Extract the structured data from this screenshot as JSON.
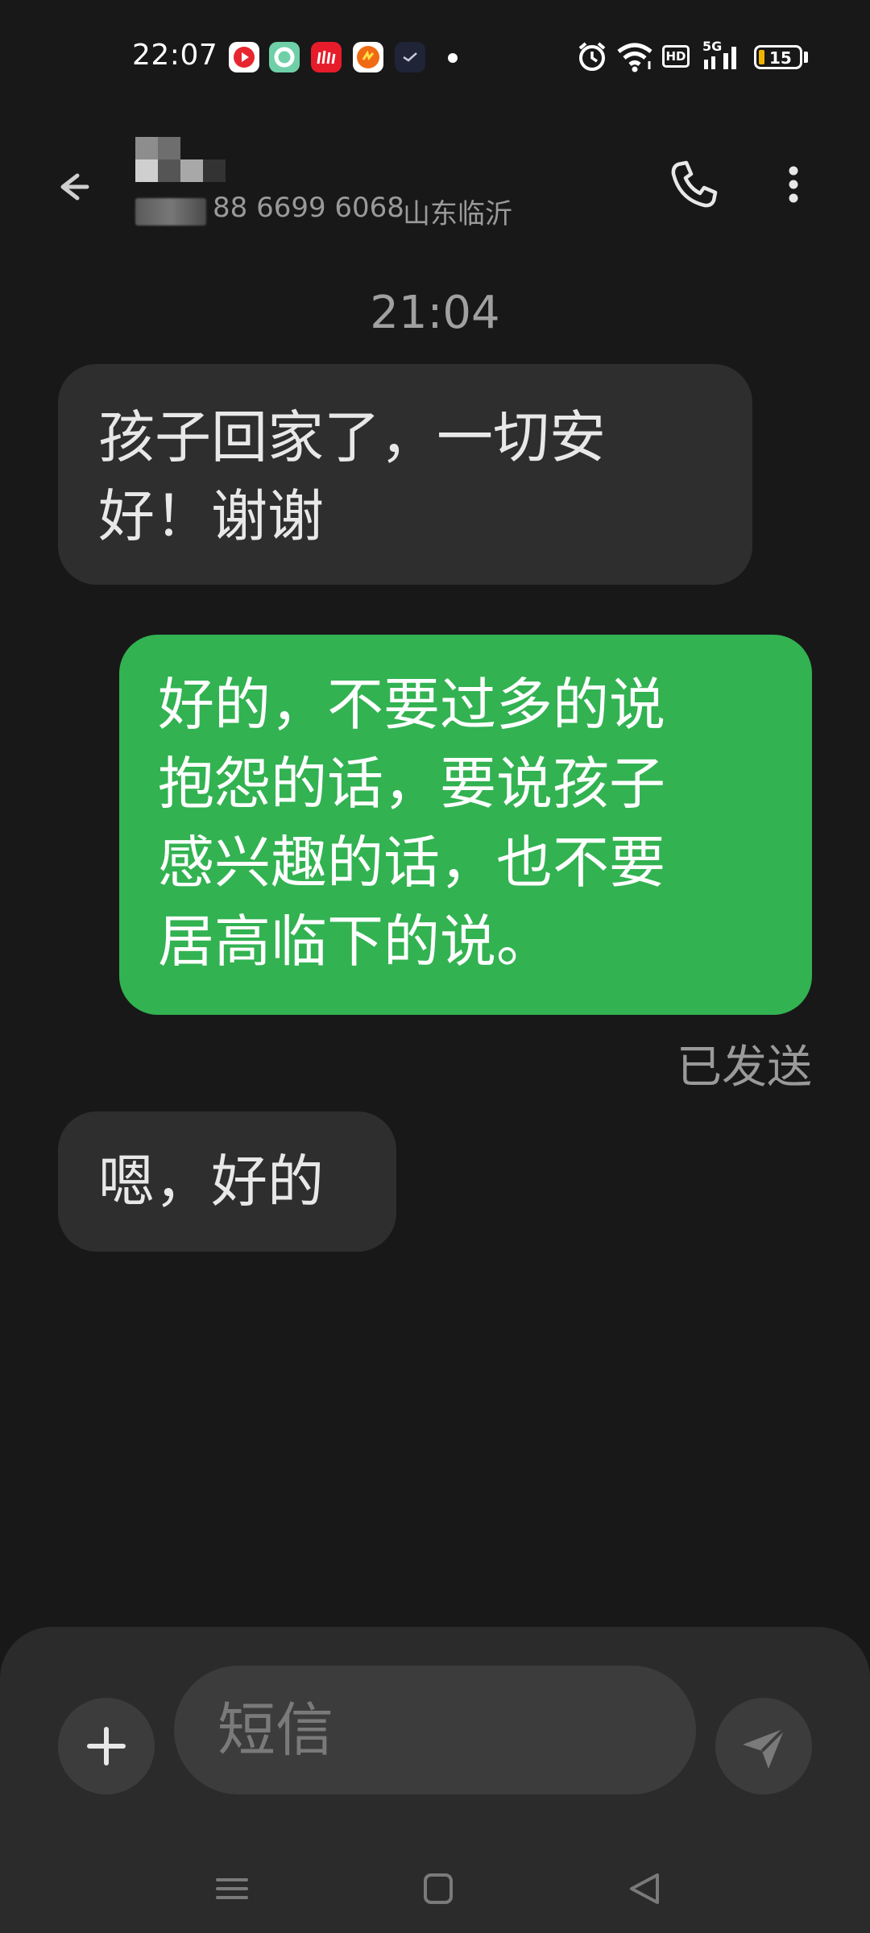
{
  "status_bar": {
    "time": "22:07",
    "notification_apps": [
      "video-app-icon",
      "green-ring-app-icon",
      "weibo-app-icon",
      "orange-app-icon",
      "check-app-icon"
    ],
    "icons": [
      "alarm-icon",
      "wifi-icon",
      "hd-icon",
      "5g-signal-icon"
    ],
    "network_label": "5G",
    "hd_label": "HD",
    "battery": {
      "level": 15,
      "text": "15",
      "fill_color": "#f0b400"
    }
  },
  "header": {
    "contact_number": "88 6699 6068",
    "contact_location": "山东临沂"
  },
  "conversation": {
    "timestamp": "21:04",
    "messages": [
      {
        "direction": "incoming",
        "lines": [
          "孩子回家了，一切安",
          "好！谢谢"
        ]
      },
      {
        "direction": "outgoing",
        "lines": [
          "好的，不要过多的说",
          "抱怨的话，要说孩子",
          "感兴趣的话，也不要",
          "居高临下的说。"
        ],
        "status": "已发送"
      },
      {
        "direction": "incoming",
        "lines": [
          "嗯，好的"
        ]
      }
    ]
  },
  "composer": {
    "placeholder": "短信"
  },
  "colors": {
    "background": "#181818",
    "incoming_bubble": "#2e2e2e",
    "outgoing_bubble": "#32b251",
    "composer": "#2b2b2b"
  }
}
